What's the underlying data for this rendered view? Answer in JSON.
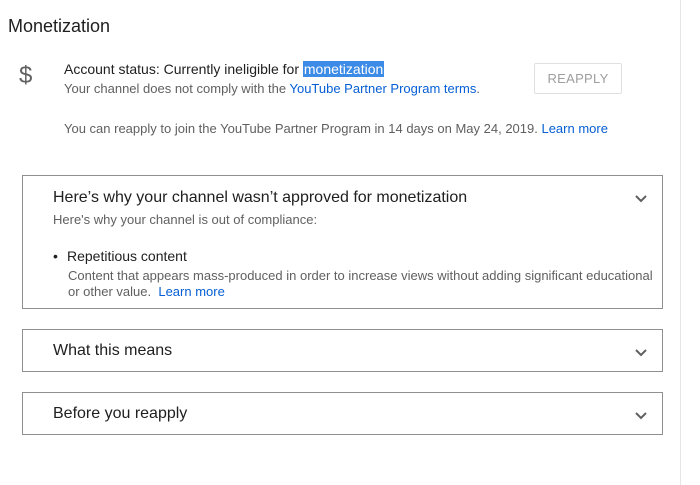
{
  "page": {
    "title": "Monetization"
  },
  "status": {
    "prefix": "Account status: Currently ineligible for ",
    "highlighted": "monetization",
    "sub_prefix": "Your channel does not comply with the ",
    "sub_link": "YouTube Partner Program terms",
    "sub_suffix": ".",
    "icon": "dollar-icon",
    "icon_glyph": "$"
  },
  "reapply_button": {
    "label": "REAPPLY",
    "disabled": true
  },
  "reapply_note": {
    "text": "You can reapply to join the YouTube Partner Program in 14 days on May 24, 2019. ",
    "link": "Learn more"
  },
  "panels": [
    {
      "title": "Here’s why your channel wasn’t approved for monetization",
      "subtitle": "Here's why your channel is out of compliance:",
      "expanded": true,
      "reasons": [
        {
          "title": "Repetitious content",
          "description": "Content that appears mass-produced in order to increase views without adding significant educational or other value.",
          "link": "Learn more"
        }
      ]
    },
    {
      "title": "What this means",
      "expanded": false
    },
    {
      "title": "Before you reapply",
      "expanded": false
    }
  ],
  "colors": {
    "link": "#065fd4",
    "highlight": "#3c8be6",
    "border": "#909090"
  }
}
